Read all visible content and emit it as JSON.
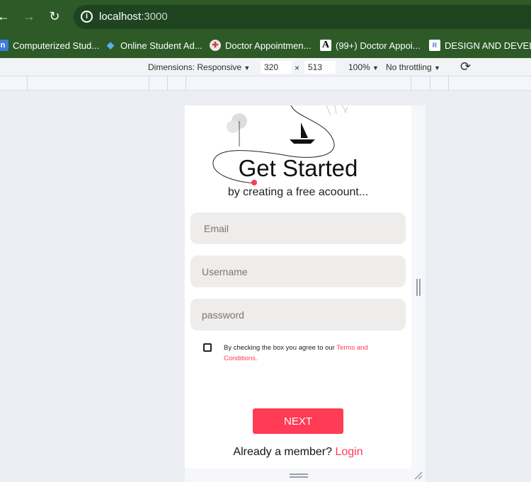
{
  "browser": {
    "url_host": "localhost",
    "url_port": ":3000",
    "back_glyph": "←",
    "forward_glyph": "→",
    "reload_glyph": "↻",
    "info_glyph": "i"
  },
  "bookmarks": [
    {
      "label": "Computerized Stud...",
      "icon": "n-logo-icon",
      "glyph": "n",
      "color": "#3b7ddd"
    },
    {
      "label": "Online Student Ad...",
      "icon": "drupal-icon",
      "glyph": "◆",
      "color": "#2b8cc4"
    },
    {
      "label": "Doctor Appointmen...",
      "icon": "doctor-icon",
      "glyph": "✚",
      "color": "#e8e8e8"
    },
    {
      "label": "(99+) Doctor Appoi...",
      "icon": "academia-icon",
      "glyph": "A",
      "color": "#ffffff"
    },
    {
      "label": "DESIGN AND DEVEL...",
      "icon": "document-icon",
      "glyph": "R",
      "color": "#4a7bd0"
    }
  ],
  "devtools": {
    "dimensions_label": "Dimensions: Responsive",
    "width": "320",
    "times": "×",
    "height": "513",
    "zoom": "100%",
    "throttling": "No throttling",
    "dropdown_glyph": "▼",
    "rotate_glyph": "⟳"
  },
  "app": {
    "title": "Get Started",
    "subtitle": "by creating a free acoount...",
    "email_placeholder": "Email",
    "username_placeholder": "Username",
    "password_placeholder": "password",
    "terms_text": "By checking the box you agree to our ",
    "terms_link": "Terms and Conditions.",
    "next_label": "NEXT",
    "member_text": "Already a member? ",
    "login_label": "Login"
  },
  "colors": {
    "chrome_green": "#2d5a27",
    "accent": "#ff3b55",
    "field_bg": "#efedeb"
  }
}
